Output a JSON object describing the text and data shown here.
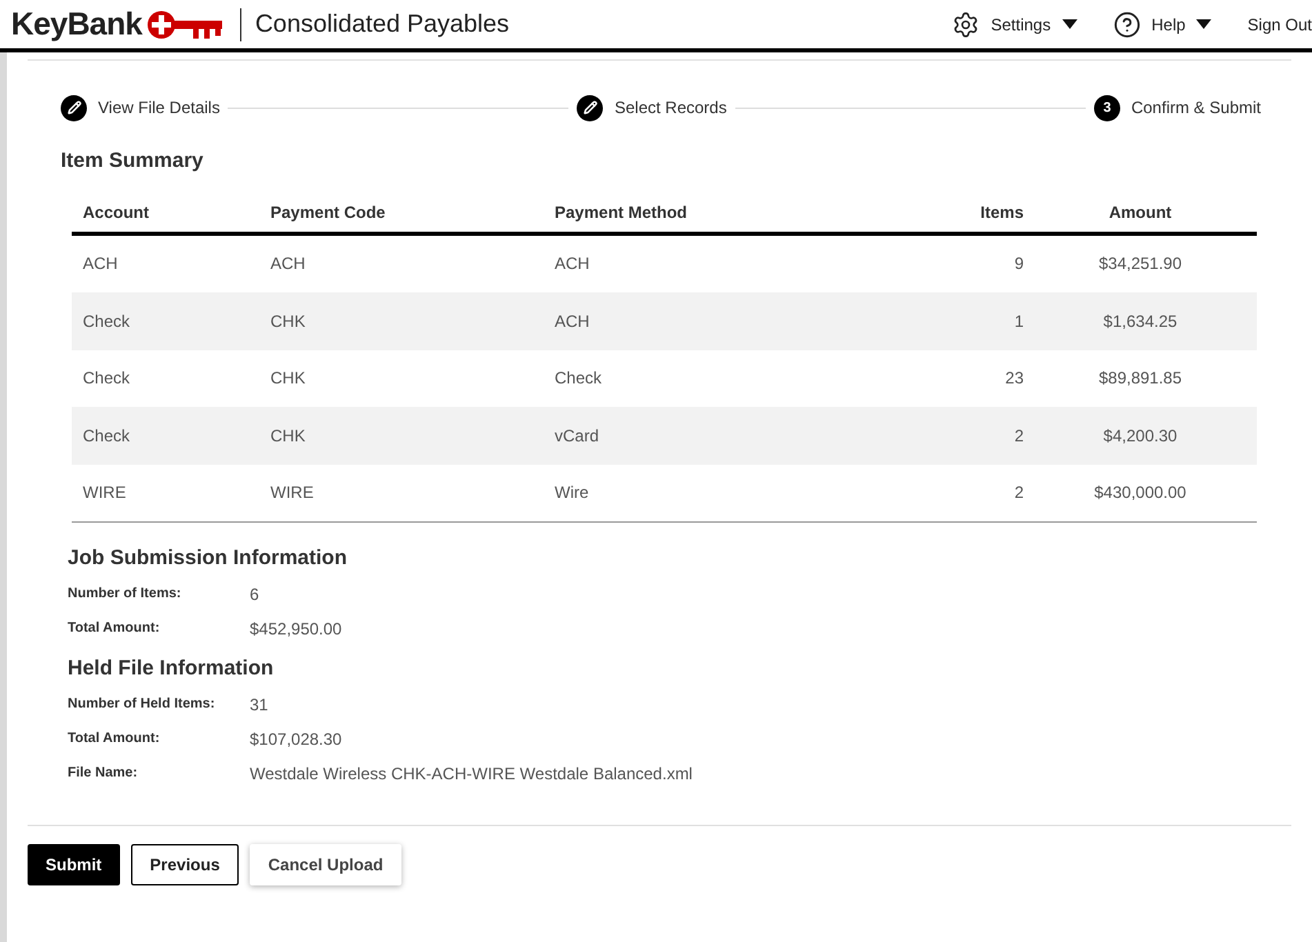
{
  "header": {
    "brand": "KeyBank",
    "app_title": "Consolidated Payables",
    "menu": [
      {
        "kind": "settings",
        "label": "Settings"
      },
      {
        "kind": "help",
        "label": "Help"
      },
      {
        "kind": "plain",
        "label": "Sign Out"
      }
    ]
  },
  "steps": [
    {
      "kind": "done",
      "label": "View File Details"
    },
    {
      "kind": "done",
      "label": "Select Records"
    },
    {
      "kind": "current",
      "number": "3",
      "label": "Confirm & Submit"
    }
  ],
  "item_summary": {
    "title": "Item Summary",
    "columns": [
      "Account",
      "Payment Code",
      "Payment Method",
      "Items",
      "Amount"
    ],
    "rows": [
      [
        "ACH",
        "ACH",
        "ACH",
        "9",
        "$34,251.90"
      ],
      [
        "Check",
        "CHK",
        "ACH",
        "1",
        "$1,634.25"
      ],
      [
        "Check",
        "CHK",
        "Check",
        "23",
        "$89,891.85"
      ],
      [
        "Check",
        "CHK",
        "vCard",
        "2",
        "$4,200.30"
      ],
      [
        "WIRE",
        "WIRE",
        "Wire",
        "2",
        "$430,000.00"
      ]
    ]
  },
  "job_submission": {
    "title": "Job Submission Information",
    "fields": [
      {
        "label": "Number of Items:",
        "value": "6"
      },
      {
        "label": "Total Amount:",
        "value": "$452,950.00"
      }
    ]
  },
  "held_file": {
    "title": "Held File Information",
    "fields": [
      {
        "label": "Number of Held Items:",
        "value": "31"
      },
      {
        "label": "Total Amount:",
        "value": "$107,028.30"
      },
      {
        "label": "File Name:",
        "value": "Westdale Wireless CHK-ACH-WIRE Westdale Balanced.xml"
      }
    ]
  },
  "buttons": [
    {
      "kind": "primary",
      "label": "Submit"
    },
    {
      "kind": "outline",
      "label": "Previous"
    },
    {
      "kind": "shadow",
      "label": "Cancel Upload"
    }
  ]
}
